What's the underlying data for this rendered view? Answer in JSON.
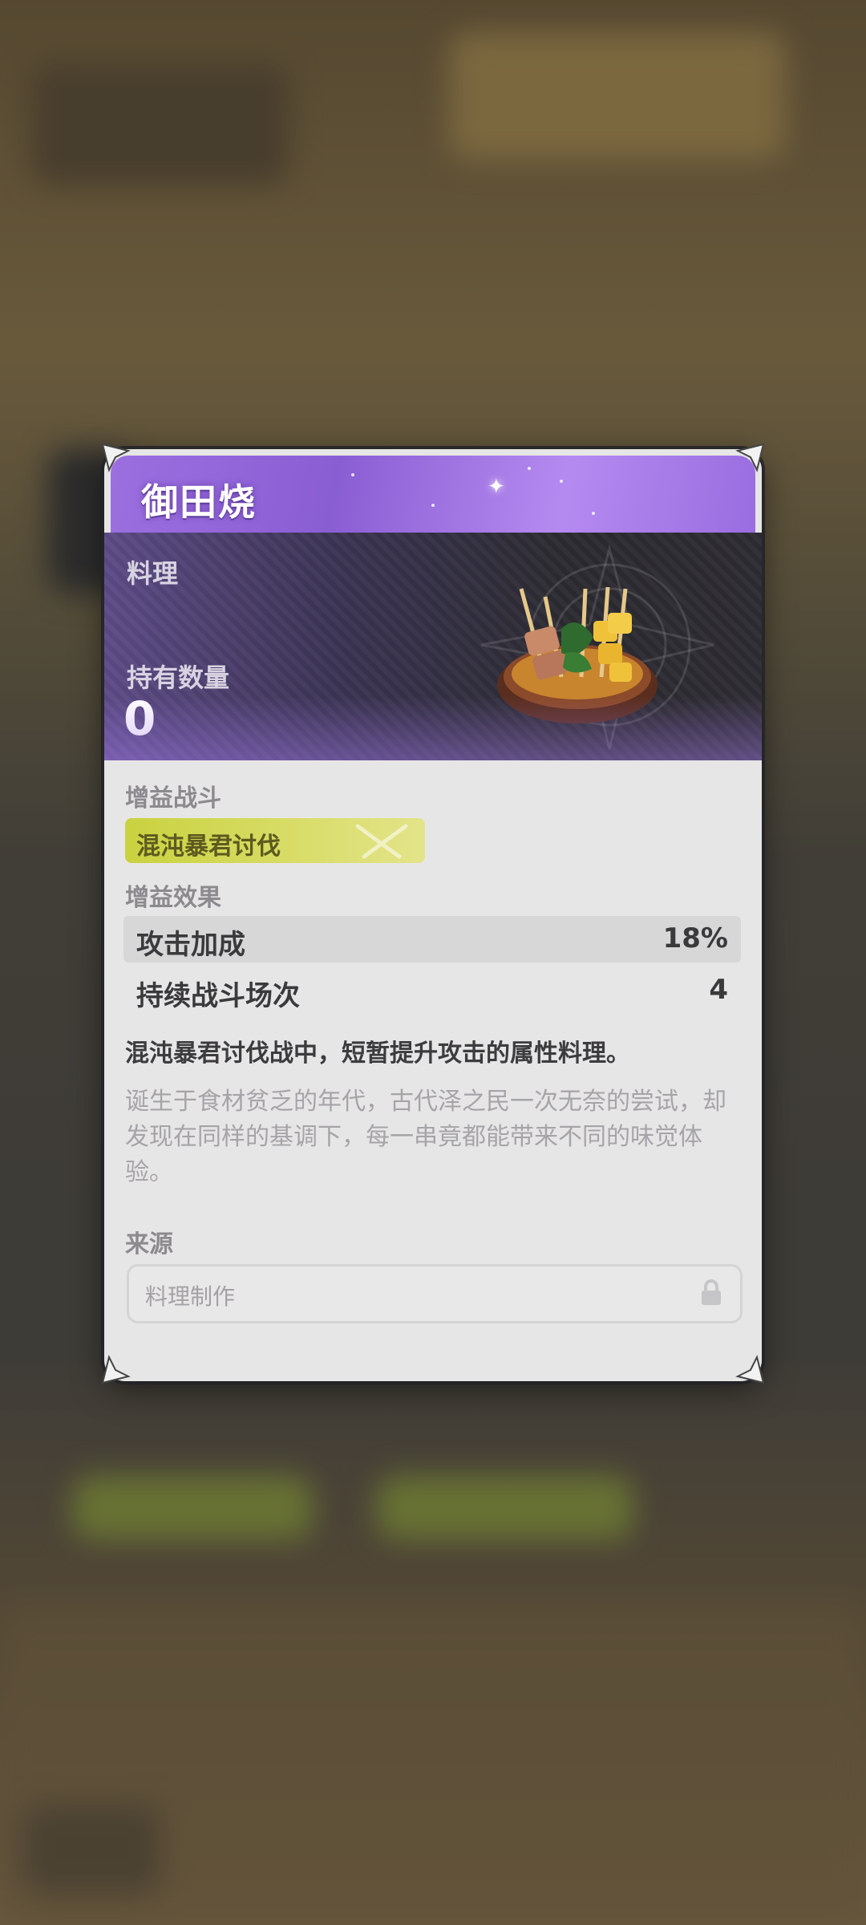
{
  "item": {
    "name": "御田烧",
    "category": "料理",
    "owned_label": "持有数量",
    "owned_value": "0"
  },
  "boost_battle": {
    "label": "增益战斗",
    "tag": "混沌暴君讨伐"
  },
  "boost_effect": {
    "label": "增益效果",
    "rows": [
      {
        "label": "攻击加成",
        "value": "18%"
      },
      {
        "label": "持续战斗场次",
        "value": "4"
      }
    ]
  },
  "description": {
    "main": "混沌暴君讨伐战中，短暂提升攻击的属性料理。",
    "flavor": "诞生于食材贫乏的年代，古代泽之民一次无奈的尝试，却发现在同样的基调下，每一串竟都能带来不同的味觉体验。"
  },
  "source": {
    "label": "来源",
    "value": "料理制作",
    "icon": "lock-icon"
  },
  "colors": {
    "title_purple": "#9c6fe0",
    "tag_yellow": "#c9d23f",
    "card_bg": "#e7e6e6"
  }
}
